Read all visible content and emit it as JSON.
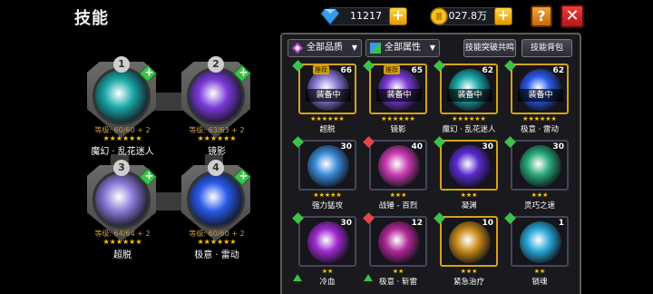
{
  "header": {
    "title": "技能"
  },
  "resources": {
    "gems": "11217",
    "gold": "1027.8万",
    "plus": "+"
  },
  "buttons": {
    "help": "?",
    "close": "✕"
  },
  "equipped": [
    {
      "number": "1",
      "level_text": "等级: 60/60 + 2",
      "stars": "★★★★★★",
      "name": "魔幻 · 乱花迷人",
      "color": "#1aa8a8"
    },
    {
      "number": "2",
      "level_text": "等级: 63/63 + 2",
      "stars": "★★★★★★",
      "name": "镜影",
      "color": "#7a3ad8"
    },
    {
      "number": "3",
      "level_text": "等级: 64/64 + 2",
      "stars": "★★★★★★",
      "name": "超脱",
      "color": "#8a7ad8"
    },
    {
      "number": "4",
      "level_text": "等级: 60/60 + 2",
      "stars": "★★★★★★",
      "name": "极意 · 雷动",
      "color": "#2a5ae8"
    }
  ],
  "panel": {
    "filter_quality": "全部品质",
    "filter_attribute": "全部属性",
    "dropdown_arrow": "▼",
    "breakthrough_button": "技能突破共鸣",
    "bag_button": "技能背包"
  },
  "cards": [
    {
      "level": "66",
      "name": "超脱",
      "stars": "★★★★★★",
      "equipped": "装备中",
      "recommend": "推荐",
      "border": "gold",
      "color": "#8a7ad8",
      "diamond": "#3cc24a"
    },
    {
      "level": "65",
      "name": "镜影",
      "stars": "★★★★★★",
      "equipped": "装备中",
      "recommend": "推荐",
      "border": "gold",
      "color": "#7a3ad8",
      "diamond": "#3cc24a"
    },
    {
      "level": "62",
      "name": "魔幻 · 乱花迷人",
      "stars": "★★★★★★",
      "equipped": "装备中",
      "recommend": "",
      "border": "gold",
      "color": "#1aa8a8",
      "diamond": "#3cc24a"
    },
    {
      "level": "62",
      "name": "极意 · 雷动",
      "stars": "★★★★★★",
      "equipped": "装备中",
      "recommend": "",
      "border": "gold",
      "color": "#2a5ae8",
      "diamond": "#3cc24a"
    },
    {
      "level": "30",
      "name": "强力猛攻",
      "stars": "★★★★★",
      "equipped": "",
      "recommend": "",
      "border": "blue",
      "color": "#3a8ad8",
      "diamond": "#3cc24a"
    },
    {
      "level": "40",
      "name": "战锤 - 百烈",
      "stars": "★★★",
      "equipped": "",
      "recommend": "",
      "border": "blue",
      "color": "#c83ab0",
      "diamond": "#e04848"
    },
    {
      "level": "30",
      "name": "凝渊",
      "stars": "★★★",
      "equipped": "",
      "recommend": "",
      "border": "gold",
      "color": "#5a2ad0",
      "diamond": "#3cc24a"
    },
    {
      "level": "30",
      "name": "灵巧之速",
      "stars": "★★★",
      "equipped": "",
      "recommend": "",
      "border": "blue",
      "color": "#28a878",
      "diamond": "#3cc24a"
    },
    {
      "level": "30",
      "name": "冷血",
      "stars": "★★",
      "equipped": "",
      "recommend": "",
      "border": "blue",
      "color": "#a02ad0",
      "diamond": "#3cc24a"
    },
    {
      "level": "12",
      "name": "极意 · 斩雷",
      "stars": "★★",
      "equipped": "",
      "recommend": "",
      "border": "blue",
      "color": "#b02898",
      "diamond": "#e04848"
    },
    {
      "level": "10",
      "name": "紧急治疗",
      "stars": "★★★",
      "equipped": "",
      "recommend": "",
      "border": "gold",
      "color": "#c88a18",
      "diamond": "#3cc24a"
    },
    {
      "level": "1",
      "name": "锁魂",
      "stars": "★★",
      "equipped": "",
      "recommend": "",
      "border": "blue",
      "color": "#28a8d8",
      "diamond": "#3cc24a"
    }
  ]
}
